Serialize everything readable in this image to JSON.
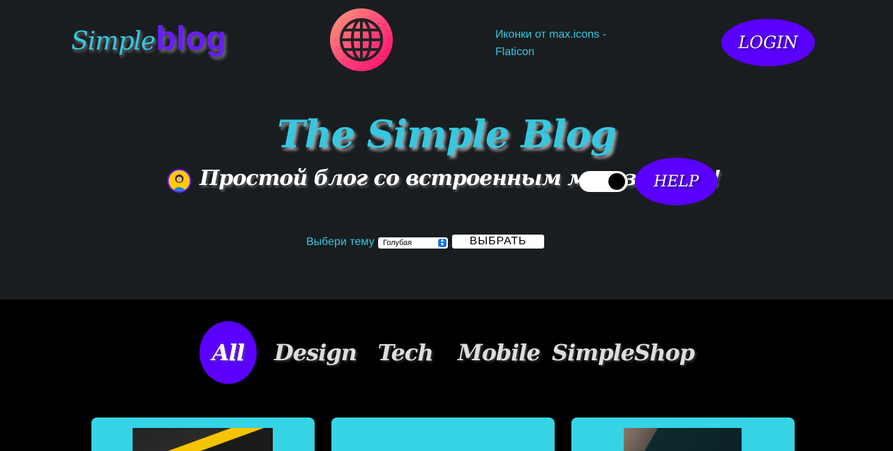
{
  "header": {
    "logo": {
      "part1": "Simple",
      "part2": "blog"
    },
    "credit_text": "Иконки от max.icons - Flaticon",
    "login_label": "LOGIN"
  },
  "hero": {
    "title": "The Simple Blog",
    "subtitle": "Простой блог со встроенным магазинном!",
    "help_label": "HELP",
    "toggle_state": "on"
  },
  "theme": {
    "label": "Выбери тему",
    "selected": "Голубая",
    "submit_label": "ВЫБРАТЬ"
  },
  "categories": {
    "items": [
      {
        "label": "All",
        "active": true
      },
      {
        "label": "Design",
        "active": false
      },
      {
        "label": "Tech",
        "active": false
      },
      {
        "label": "Mobile",
        "active": false
      },
      {
        "label": "SimpleShop",
        "active": false
      }
    ]
  },
  "colors": {
    "accent_purple": "#5a00ff",
    "accent_cyan": "#35c8e0",
    "header_bg": "#191d20",
    "card_bg": "#35d3e6"
  }
}
